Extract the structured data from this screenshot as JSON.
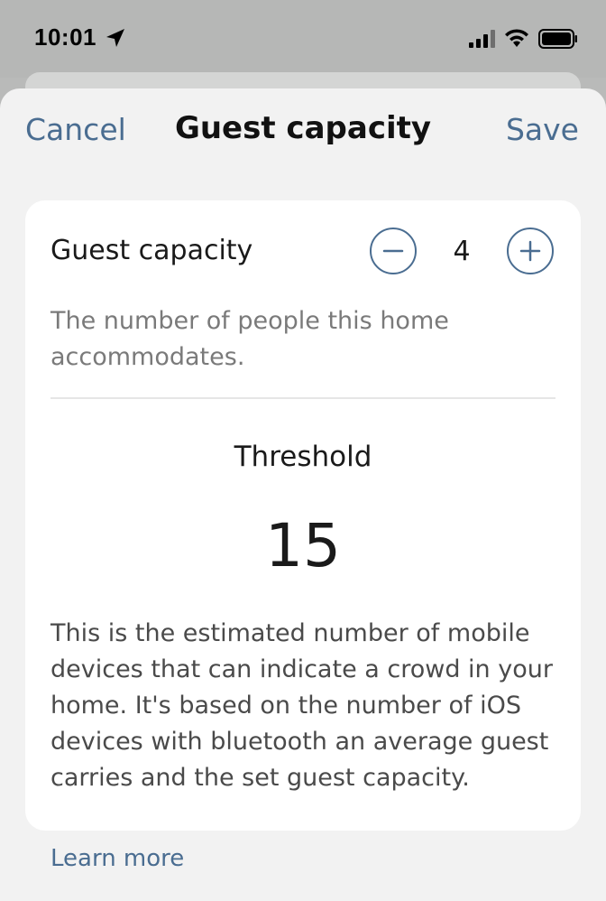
{
  "status_bar": {
    "time": "10:01",
    "icons": [
      "location-arrow-icon",
      "cellular-signal-icon",
      "wifi-icon",
      "battery-icon"
    ]
  },
  "nav": {
    "cancel_label": "Cancel",
    "title": "Guest capacity",
    "save_label": "Save"
  },
  "capacity": {
    "label": "Guest capacity",
    "value": "4",
    "description": "The number of people this home accommodates."
  },
  "threshold": {
    "label": "Threshold",
    "value": "15",
    "description": "This is the estimated number of mobile devices that can indicate a crowd in your home. It's based on the number of iOS devices with bluetooth an average guest carries and the set guest capacity."
  },
  "footer": {
    "learn_more": "Learn more"
  },
  "colors": {
    "accent": "#4a6d91",
    "sheet_background": "#f2f2f2",
    "card_background": "#ffffff"
  }
}
